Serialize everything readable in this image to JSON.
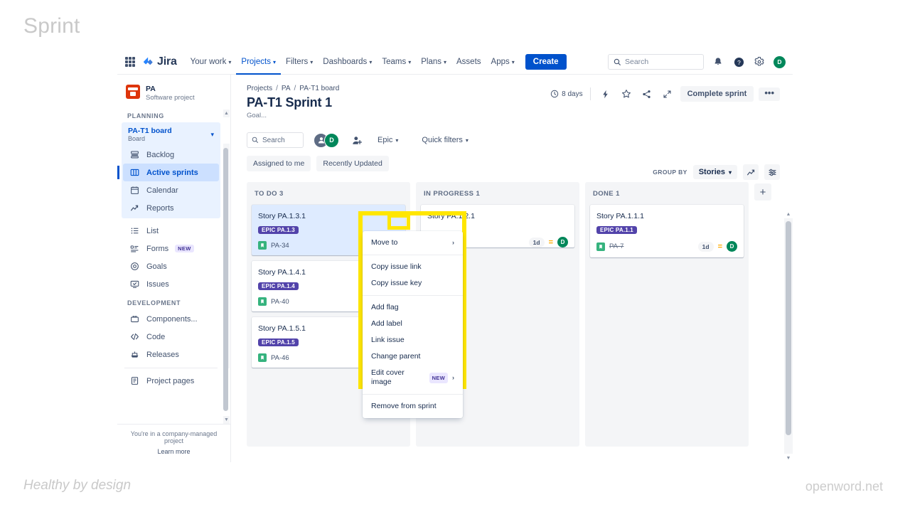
{
  "slide": {
    "title": "Sprint",
    "footer_left": "Healthy by design",
    "footer_right": "openword.net"
  },
  "topnav": {
    "logo_text": "Jira",
    "items": [
      {
        "label": "Your work",
        "caret": "⌄",
        "active": false
      },
      {
        "label": "Projects",
        "caret": "⌄",
        "active": true
      },
      {
        "label": "Filters",
        "caret": "⌄",
        "active": false
      },
      {
        "label": "Dashboards",
        "caret": "⌄",
        "active": false
      },
      {
        "label": "Teams",
        "caret": "⌄",
        "active": false
      },
      {
        "label": "Plans",
        "caret": "⌄",
        "active": false
      },
      {
        "label": "Assets",
        "caret": "",
        "active": false
      },
      {
        "label": "Apps",
        "caret": "⌄",
        "active": false
      }
    ],
    "create_label": "Create",
    "search_placeholder": "Search",
    "avatar_initial": "D"
  },
  "sidebar": {
    "project_name": "PA",
    "project_type": "Software project",
    "planning_label": "PLANNING",
    "board": {
      "name": "PA-T1 board",
      "subtitle": "Board",
      "chevron": "⌄"
    },
    "board_items": [
      {
        "label": "Backlog",
        "icon": "backlog-icon",
        "selected": false
      },
      {
        "label": "Active sprints",
        "icon": "board-columns-icon",
        "selected": true
      },
      {
        "label": "Calendar",
        "icon": "calendar-icon",
        "selected": false
      },
      {
        "label": "Reports",
        "icon": "reports-chart-icon",
        "selected": false
      }
    ],
    "plain_items": [
      {
        "label": "List",
        "icon": "list-icon",
        "badge": ""
      },
      {
        "label": "Forms",
        "icon": "forms-icon",
        "badge": "NEW"
      },
      {
        "label": "Goals",
        "icon": "goals-target-icon",
        "badge": ""
      },
      {
        "label": "Issues",
        "icon": "issues-screen-icon",
        "badge": ""
      }
    ],
    "development_label": "DEVELOPMENT",
    "dev_items": [
      {
        "label": "Components...",
        "icon": "components-icon"
      },
      {
        "label": "Code",
        "icon": "code-brackets-icon"
      },
      {
        "label": "Releases",
        "icon": "releases-ship-icon"
      }
    ],
    "extra_items": [
      {
        "label": "Project pages",
        "icon": "pages-icon"
      }
    ],
    "footer_line1": "You're in a company-managed project",
    "footer_line2": "Learn more"
  },
  "main": {
    "breadcrumbs": [
      "Projects",
      "PA",
      "PA-T1 board"
    ],
    "breadcrumb_separator": "/",
    "title": "PA-T1 Sprint 1",
    "goal": "Goal...",
    "days_remaining": "8 days",
    "complete_sprint_label": "Complete sprint",
    "more_label": "•••"
  },
  "toolbar": {
    "search_placeholder": "Search",
    "avatars": [
      {
        "initial": "",
        "name": "user-avatar-generic"
      },
      {
        "initial": "D",
        "name": "user-avatar-d"
      }
    ],
    "add_people_icon": "add-person-icon",
    "epic_label": "Epic",
    "quick_filters_label": "Quick filters",
    "caret": "⌄",
    "group_by_label": "GROUP BY",
    "group_by_value": "Stories",
    "chips": [
      "Assigned to me",
      "Recently Updated"
    ]
  },
  "board": {
    "add_column_label": "+",
    "columns": [
      {
        "name": "TO DO",
        "count": "3",
        "cards": [
          {
            "title": "Story PA.1.3.1",
            "epic": "EPIC PA.1.3",
            "key": "PA-34",
            "key_done": false,
            "estimate": "",
            "priority": "",
            "assignee": "",
            "selected": true,
            "has_dots": true
          },
          {
            "title": "Story PA.1.4.1",
            "epic": "EPIC PA.1.4",
            "key": "PA-40",
            "key_done": false,
            "estimate": "",
            "priority": "",
            "assignee": "",
            "selected": false,
            "has_dots": false
          },
          {
            "title": "Story PA.1.5.1",
            "epic": "EPIC PA.1.5",
            "key": "PA-46",
            "key_done": false,
            "estimate": "",
            "priority": "",
            "assignee": "",
            "selected": false,
            "has_dots": false
          }
        ]
      },
      {
        "name": "IN PROGRESS",
        "count": "1",
        "cards": [
          {
            "title": "Story PA.1.2.1",
            "epic": "",
            "key": "",
            "key_done": false,
            "estimate": "1d",
            "priority": "=",
            "assignee": "D",
            "selected": false,
            "has_dots": false
          }
        ]
      },
      {
        "name": "DONE",
        "count": "1",
        "cards": [
          {
            "title": "Story PA.1.1.1",
            "epic": "EPIC PA.1.1",
            "key": "PA-7",
            "key_done": true,
            "estimate": "1d",
            "priority": "=",
            "assignee": "D",
            "selected": false,
            "has_dots": false
          }
        ]
      }
    ]
  },
  "context_menu": {
    "items": [
      {
        "label": "Move to",
        "arrow": "›",
        "badge": "",
        "sep_after": true
      },
      {
        "label": "Copy issue link",
        "arrow": "",
        "badge": "",
        "sep_after": false
      },
      {
        "label": "Copy issue key",
        "arrow": "",
        "badge": "",
        "sep_after": true
      },
      {
        "label": "Add flag",
        "arrow": "",
        "badge": "",
        "sep_after": false
      },
      {
        "label": "Add label",
        "arrow": "",
        "badge": "",
        "sep_after": false
      },
      {
        "label": "Link issue",
        "arrow": "",
        "badge": "",
        "sep_after": false
      },
      {
        "label": "Change parent",
        "arrow": "",
        "badge": "",
        "sep_after": false
      },
      {
        "label": "Edit cover image",
        "arrow": "›",
        "badge": "NEW",
        "sep_after": true
      },
      {
        "label": "Remove from sprint",
        "arrow": "",
        "badge": "",
        "sep_after": false
      }
    ]
  },
  "colors": {
    "brand_blue": "#0052cc",
    "epic_purple": "#5243aa",
    "story_green": "#36b37e",
    "avatar_green": "#00875a",
    "highlight_yellow": "#ffe600",
    "project_avatar_red": "#de350b"
  }
}
